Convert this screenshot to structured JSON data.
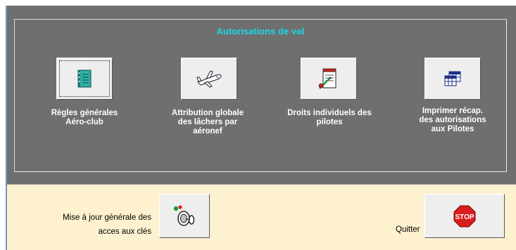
{
  "section": {
    "title": "Autorisations de vol"
  },
  "tools": [
    {
      "label_lines": [
        "Règles générales",
        "Aéro-club"
      ],
      "icon": "notebook-icon"
    },
    {
      "label_lines": [
        "Attribution globale",
        "des lâchers par",
        "aéronef"
      ],
      "icon": "airplane-icon"
    },
    {
      "label_lines": [
        "Droits  individuels des",
        "pilotes"
      ],
      "icon": "document-pen-icon"
    },
    {
      "label_lines": [
        "Imprimer récap.",
        "des autorisations",
        "aux Pilotes"
      ],
      "icon": "table-grid-icon"
    }
  ],
  "bottom": {
    "update_label_lines": [
      "Mise à jour générale des",
      "acces aux clés"
    ],
    "update_icon": "key-switch-icon",
    "quit_label": "Quitter",
    "quit_icon": "stop-sign-icon",
    "stop_text": "STOP"
  },
  "colors": {
    "panel": "#6f6f6f",
    "title": "#19d7e6",
    "bottom_panel": "#fdf1cf",
    "stop_red": "#d81e1e"
  }
}
